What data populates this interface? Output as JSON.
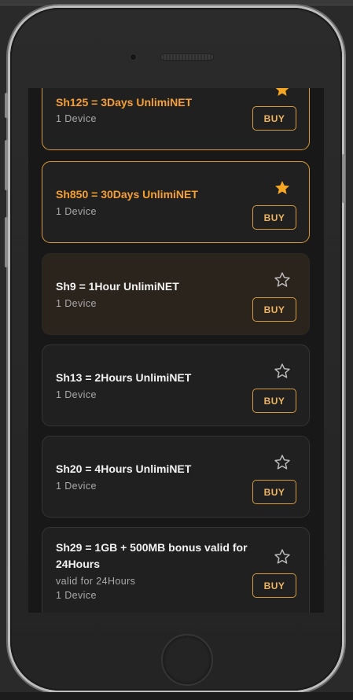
{
  "buy_label": "BUY",
  "accent_color": "#f5a030",
  "packages": [
    {
      "title": "Sh125 = 3Days UnlimiNET",
      "lines": [
        "1 Device"
      ],
      "favorite": true
    },
    {
      "title": "Sh850 = 30Days UnlimiNET",
      "lines": [
        "1 Device"
      ],
      "favorite": true
    },
    {
      "title": "Sh9 = 1Hour UnlimiNET",
      "lines": [
        "1 Device"
      ],
      "favorite": false,
      "highlighted": true
    },
    {
      "title": "Sh13 = 2Hours UnlimiNET",
      "lines": [
        "1 Device"
      ],
      "favorite": false
    },
    {
      "title": "Sh20 = 4Hours UnlimiNET",
      "lines": [
        "1 Device"
      ],
      "favorite": false
    },
    {
      "title": "Sh29 = 1GB + 500MB bonus valid for 24Hours",
      "lines": [
        "valid for 24Hours",
        "1 Device"
      ],
      "favorite": false
    }
  ]
}
